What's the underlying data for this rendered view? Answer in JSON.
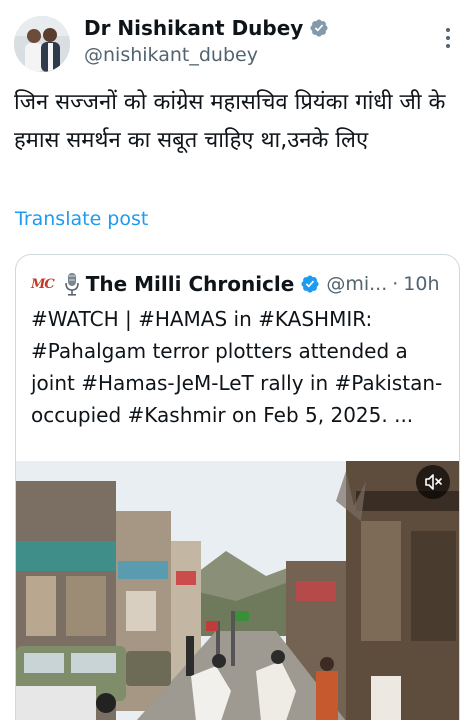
{
  "author": {
    "display_name": "Dr Nishikant Dubey",
    "handle": "@nishikant_dubey",
    "verified_icon": "verified-badge-icon",
    "avatar_icon": "avatar"
  },
  "post": {
    "text": "जिन सज्जनों को कांग्रेस महासचिव प्रियंका गांधी जी के हमास समर्थन का सबूत चाहिए था,उनके लिए",
    "translate_label": "Translate post"
  },
  "quoted_post": {
    "logo_text": "MC",
    "name": "The Milli Chronicle",
    "handle": "@mi...",
    "separator": "·",
    "time": "10h",
    "text": "#WATCH | #HAMAS in #KASHMIR: #Pahalgam terror plotters attended a joint #Hamas-JeM-LeT rally in #Pakistan-occupied #Kashmir on Feb 5, 2025. ...",
    "media_icon": "video-thumbnail",
    "mute_icon": "mute-icon"
  },
  "colors": {
    "link": "#1d9bf0",
    "secondary_text": "#536471",
    "border": "#cfd9de",
    "verified": "#1d9bf0"
  }
}
